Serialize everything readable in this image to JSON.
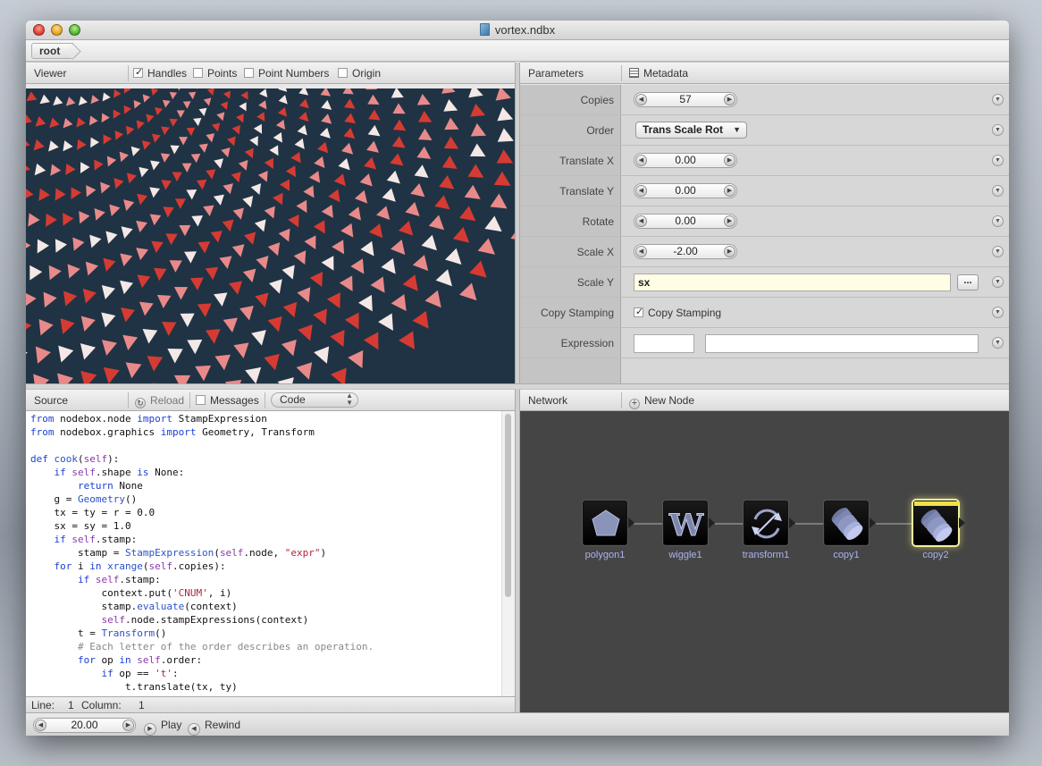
{
  "window": {
    "title": "vortex.ndbx"
  },
  "pathbar": {
    "root": "root"
  },
  "viewer": {
    "title": "Viewer",
    "options": [
      {
        "label": "Handles",
        "checked": true
      },
      {
        "label": "Points",
        "checked": false
      },
      {
        "label": "Point Numbers",
        "checked": false
      },
      {
        "label": "Origin",
        "checked": false
      }
    ],
    "colors": {
      "background": "#1f3344",
      "red": "#d63b33",
      "pink": "#e98a8a",
      "white": "#f4e8e6"
    }
  },
  "parameters": {
    "title": "Parameters",
    "metadata_label": "Metadata",
    "copies": {
      "label": "Copies",
      "value": "57"
    },
    "order": {
      "label": "Order",
      "value": "Trans Scale Rot"
    },
    "translate_x": {
      "label": "Translate X",
      "value": "0.00"
    },
    "translate_y": {
      "label": "Translate Y",
      "value": "0.00"
    },
    "rotate": {
      "label": "Rotate",
      "value": "0.00"
    },
    "scale_x": {
      "label": "Scale X",
      "value": "-2.00"
    },
    "scale_y": {
      "label": "Scale Y",
      "value": "sx",
      "button": "..."
    },
    "copy_stamping": {
      "label": "Copy Stamping",
      "checkbox_label": "Copy Stamping",
      "checked": true
    },
    "expression": {
      "label": "Expression",
      "value": ""
    }
  },
  "source": {
    "title": "Source",
    "reload": "Reload",
    "messages": "Messages",
    "mode": "Code",
    "status": {
      "line_label": "Line:",
      "line": "1",
      "column_label": "Column:",
      "column": "1"
    }
  },
  "network": {
    "title": "Network",
    "new_node": "New Node",
    "nodes": [
      {
        "name": "polygon1",
        "icon": "pentagon-icon"
      },
      {
        "name": "wiggle1",
        "icon": "wiggle-w-icon"
      },
      {
        "name": "transform1",
        "icon": "transform-arrows-icon"
      },
      {
        "name": "copy1",
        "icon": "copy-cylinders-icon"
      },
      {
        "name": "copy2",
        "icon": "copy-cylinders-icon",
        "selected": true
      }
    ],
    "label_color": "#a9b4f0"
  },
  "playback": {
    "frame": "20.00",
    "play": "Play",
    "rewind": "Rewind"
  }
}
